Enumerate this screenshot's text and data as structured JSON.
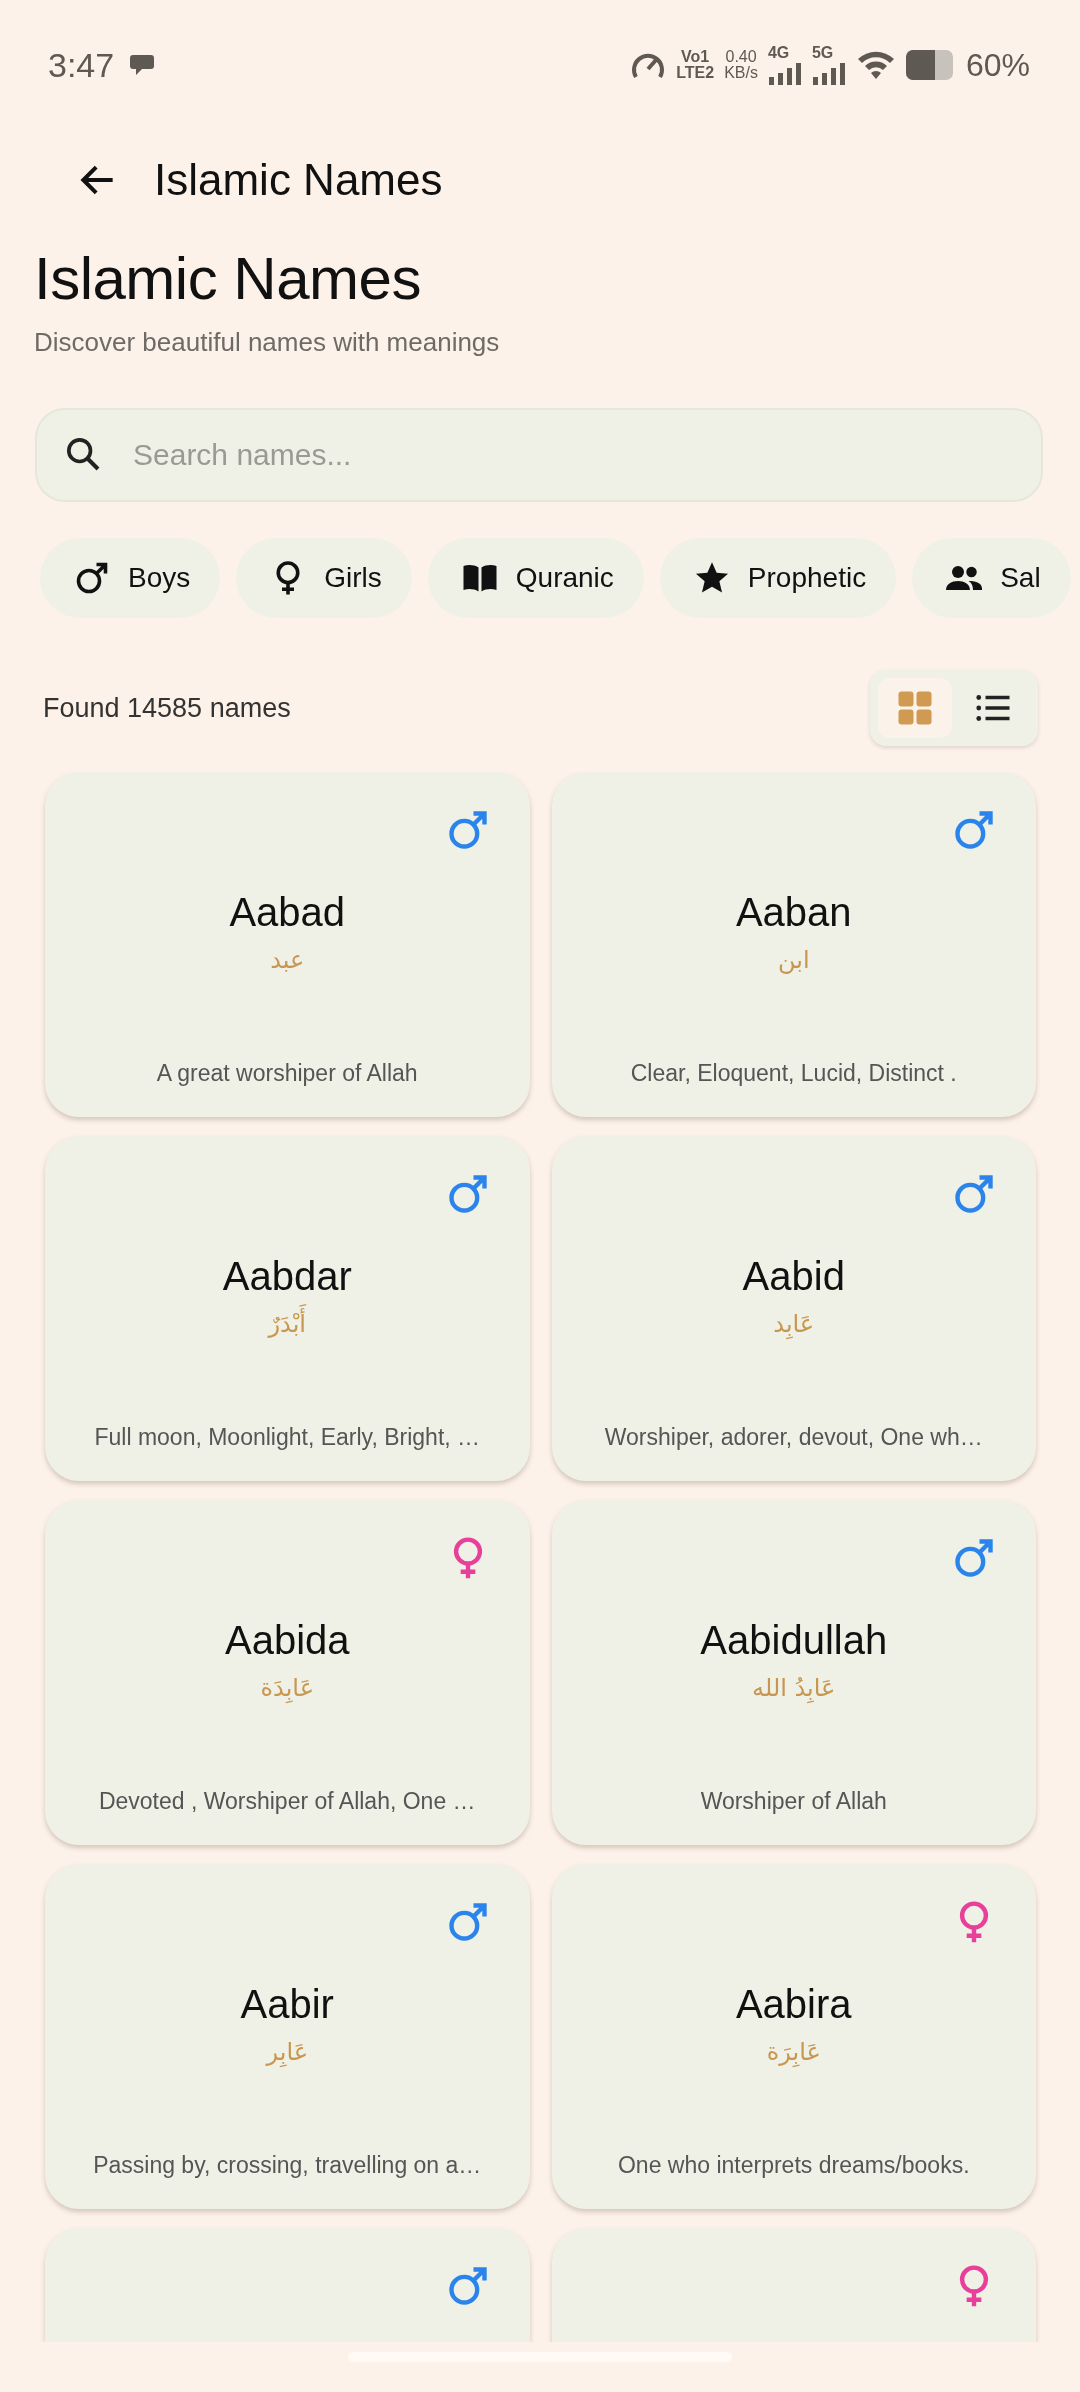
{
  "status_bar": {
    "time": "3:47",
    "volte": "Vo1",
    "lte": "LTE2",
    "speed": "0.40",
    "speed_unit": "KB/s",
    "net_1": "4G",
    "net_2": "5G",
    "battery": "60%"
  },
  "app_bar": {
    "title": "Islamic Names"
  },
  "header": {
    "title": "Islamic Names",
    "subtitle": "Discover beautiful names with meanings"
  },
  "search": {
    "placeholder": "Search names..."
  },
  "filters": [
    {
      "kind": "male",
      "label": "Boys",
      "selected": false
    },
    {
      "kind": "female",
      "label": "Girls",
      "selected": false
    },
    {
      "kind": "book",
      "label": "Quranic",
      "selected": false
    },
    {
      "kind": "star",
      "label": "Prophetic",
      "selected": false
    },
    {
      "kind": "people",
      "label": "Sal",
      "selected": false
    }
  ],
  "result_count": "Found 14585 names",
  "view_options": [
    {
      "kind": "grid",
      "selected": true
    },
    {
      "kind": "list",
      "selected": false
    }
  ],
  "names": [
    {
      "kind": "male",
      "name": "Aabad",
      "arabic": "عبد",
      "meaning": "A great worshiper of Allah"
    },
    {
      "kind": "male",
      "name": "Aaban",
      "arabic": "ابن",
      "meaning": "Clear, Eloquent, Lucid, Distinct ."
    },
    {
      "kind": "male",
      "name": "Aabdar",
      "arabic": "أَبْدَرٌ",
      "meaning": "Full moon, Moonlight, Early, Bright, …"
    },
    {
      "kind": "male",
      "name": "Aabid",
      "arabic": "عَابِد",
      "meaning": "Worshiper, adorer, devout, One wh…"
    },
    {
      "kind": "female",
      "name": "Aabida",
      "arabic": "عَابِدَة",
      "meaning": "Devoted , Worshiper of Allah, One …"
    },
    {
      "kind": "male",
      "name": "Aabidullah",
      "arabic": "عَابِدُ الله",
      "meaning": "Worshiper of Allah"
    },
    {
      "kind": "male",
      "name": "Aabir",
      "arabic": "عَابِر",
      "meaning": "Passing by, crossing, travelling on a…"
    },
    {
      "kind": "female",
      "name": "Aabira",
      "arabic": "عَابِرَة",
      "meaning": "One who interprets dreams/books."
    },
    {
      "kind": "male"
    },
    {
      "kind": "female"
    }
  ]
}
